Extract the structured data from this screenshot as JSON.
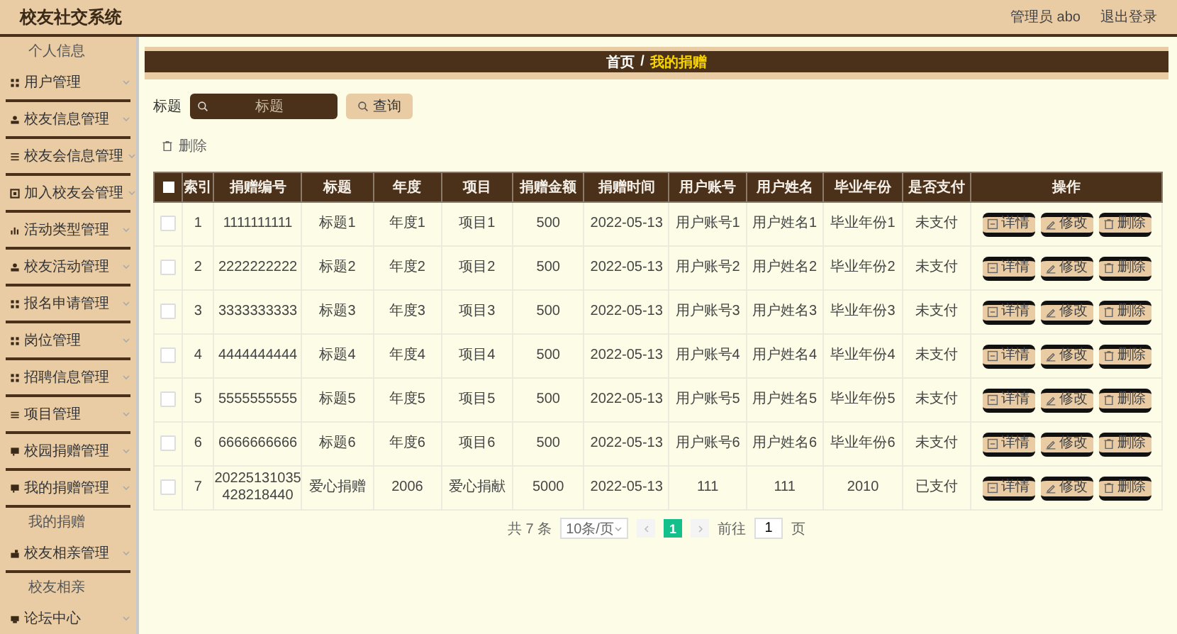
{
  "header": {
    "title": "校友社交系统",
    "user": "管理员 abo",
    "logout": "退出登录"
  },
  "sidebar": {
    "items": [
      {
        "kind": "sub",
        "label": "个人信息"
      },
      {
        "kind": "menu",
        "label": "用户管理",
        "expanded": false
      },
      {
        "kind": "menu",
        "label": "校友信息管理",
        "expanded": false
      },
      {
        "kind": "menu",
        "label": "校友会信息管理",
        "expanded": false
      },
      {
        "kind": "menu",
        "label": "加入校友会管理",
        "expanded": false
      },
      {
        "kind": "menu",
        "label": "活动类型管理",
        "expanded": false
      },
      {
        "kind": "menu",
        "label": "校友活动管理",
        "expanded": false
      },
      {
        "kind": "menu",
        "label": "报名申请管理",
        "expanded": false
      },
      {
        "kind": "menu",
        "label": "岗位管理",
        "expanded": false
      },
      {
        "kind": "menu",
        "label": "招聘信息管理",
        "expanded": false
      },
      {
        "kind": "menu",
        "label": "项目管理",
        "expanded": false
      },
      {
        "kind": "menu",
        "label": "校园捐赠管理",
        "expanded": false
      },
      {
        "kind": "menu",
        "label": "我的捐赠管理",
        "expanded": false
      },
      {
        "kind": "sub",
        "label": "我的捐赠"
      },
      {
        "kind": "menu",
        "label": "校友相亲管理",
        "expanded": false
      },
      {
        "kind": "sub",
        "label": "校友相亲"
      },
      {
        "kind": "menu",
        "label": "论坛中心",
        "expanded": false
      }
    ]
  },
  "breadcrumb": {
    "home": "首页",
    "separator": "/",
    "current": "我的捐赠"
  },
  "search": {
    "label": "标题",
    "placeholder": "标题",
    "button": "查询"
  },
  "delete_button": "删除",
  "table": {
    "all_checked": false,
    "columns": [
      "索引",
      "捐赠编号",
      "标题",
      "年度",
      "项目",
      "捐赠金额",
      "捐赠时间",
      "用户账号",
      "用户姓名",
      "毕业年份",
      "是否支付",
      "操作"
    ],
    "rows": [
      {
        "checked": false,
        "cells": [
          "1",
          "1111111111",
          "标题1",
          "年度1",
          "项目1",
          "500",
          "2022-05-13",
          "用户账号1",
          "用户姓名1",
          "毕业年份1",
          "未支付"
        ],
        "actions": [
          "详情",
          "修改",
          "删除"
        ]
      },
      {
        "checked": false,
        "cells": [
          "2",
          "2222222222",
          "标题2",
          "年度2",
          "项目2",
          "500",
          "2022-05-13",
          "用户账号2",
          "用户姓名2",
          "毕业年份2",
          "未支付"
        ],
        "actions": [
          "详情",
          "修改",
          "删除"
        ]
      },
      {
        "checked": false,
        "cells": [
          "3",
          "3333333333",
          "标题3",
          "年度3",
          "项目3",
          "500",
          "2022-05-13",
          "用户账号3",
          "用户姓名3",
          "毕业年份3",
          "未支付"
        ],
        "actions": [
          "详情",
          "修改",
          "删除"
        ]
      },
      {
        "checked": false,
        "cells": [
          "4",
          "4444444444",
          "标题4",
          "年度4",
          "项目4",
          "500",
          "2022-05-13",
          "用户账号4",
          "用户姓名4",
          "毕业年份4",
          "未支付"
        ],
        "actions": [
          "详情",
          "修改",
          "删除"
        ]
      },
      {
        "checked": false,
        "cells": [
          "5",
          "5555555555",
          "标题5",
          "年度5",
          "项目5",
          "500",
          "2022-05-13",
          "用户账号5",
          "用户姓名5",
          "毕业年份5",
          "未支付"
        ],
        "actions": [
          "详情",
          "修改",
          "删除"
        ]
      },
      {
        "checked": false,
        "cells": [
          "6",
          "6666666666",
          "标题6",
          "年度6",
          "项目6",
          "500",
          "2022-05-13",
          "用户账号6",
          "用户姓名6",
          "毕业年份6",
          "未支付"
        ],
        "actions": [
          "详情",
          "修改",
          "删除"
        ]
      },
      {
        "checked": false,
        "cells": [
          "7",
          "20225131035428218440",
          "爱心捐赠",
          "2006",
          "爱心捐献",
          "5000",
          "2022-05-13",
          "111",
          "111",
          "2010",
          "已支付"
        ],
        "actions": [
          "详情",
          "修改",
          "删除"
        ]
      }
    ]
  },
  "pagination": {
    "total": "共 7 条",
    "page_size": "10条/页",
    "pages": [
      {
        "label": "1",
        "selected": true
      }
    ],
    "goto_label": "前往",
    "goto_value": "1",
    "page_unit": "页"
  }
}
